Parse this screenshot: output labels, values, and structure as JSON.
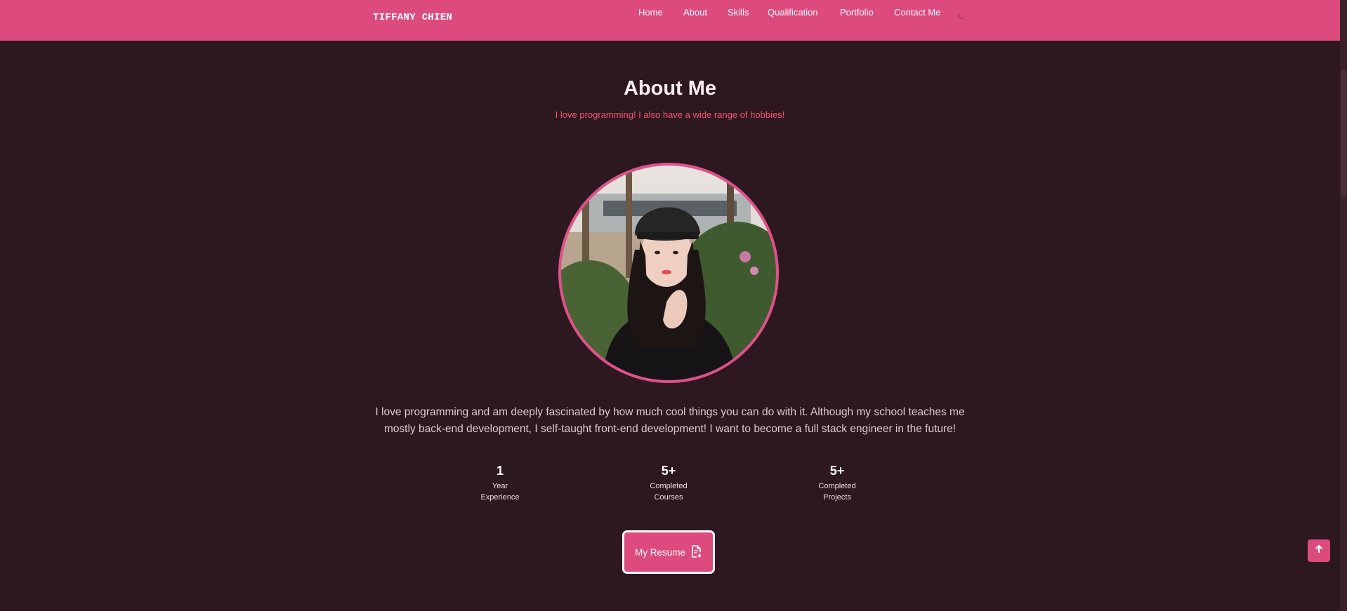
{
  "header": {
    "logo": "TIFFANY CHIEN",
    "nav": [
      {
        "label": "Home"
      },
      {
        "label": "About"
      },
      {
        "label": "Skills"
      },
      {
        "label": "Qualification"
      },
      {
        "label": "Portfolio"
      },
      {
        "label": "Contact Me"
      }
    ],
    "theme_icon": "moon-icon"
  },
  "about": {
    "title": "About Me",
    "subtitle": "I love programming! I also have a wide range of hobbies!",
    "description_line1": "I love programming and am deeply fascinated by how much cool things you can do with it. Although my school teaches me",
    "description_line2": "mostly back-end development, I self-taught front-end development! I want to become a full stack engineer in the future!",
    "stats": [
      {
        "number": "1",
        "line1": "Year",
        "line2": "Experience"
      },
      {
        "number": "5+",
        "line1": "Completed",
        "line2": "Courses"
      },
      {
        "number": "5+",
        "line1": "Completed",
        "line2": "Projects"
      }
    ],
    "resume_button": "My Resume",
    "resume_icon": "document-download-icon"
  },
  "scroll_top_icon": "arrow-up-icon",
  "colors": {
    "accent": "#dd4a7e",
    "background": "#2e1820",
    "subtitle": "#f0566e"
  }
}
